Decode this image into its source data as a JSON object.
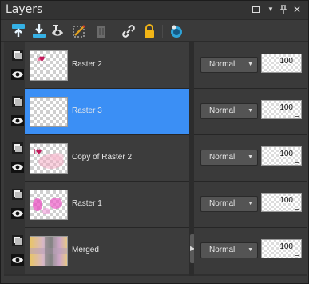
{
  "panel": {
    "title": "Layers",
    "title_buttons": [
      "restore-icon",
      "menu-dropdown-icon",
      "pin-icon",
      "close-icon"
    ]
  },
  "toolbar": {
    "tools": [
      "new-layer-icon",
      "merge-down-icon",
      "visibility-toggle-icon",
      "edit-selection-icon",
      "delete-layer-icon",
      "link-icon",
      "lock-icon",
      "layer-styles-icon"
    ]
  },
  "layers": [
    {
      "name": "Raster 2",
      "selected": false,
      "visible": true,
      "blend_mode": "Normal",
      "opacity": "100"
    },
    {
      "name": "Raster 3",
      "selected": true,
      "visible": true,
      "blend_mode": "Normal",
      "opacity": "100"
    },
    {
      "name": "Copy of Raster 2",
      "selected": false,
      "visible": true,
      "blend_mode": "Normal",
      "opacity": "100"
    },
    {
      "name": "Raster 1",
      "selected": false,
      "visible": true,
      "blend_mode": "Normal",
      "opacity": "100"
    },
    {
      "name": "Merged",
      "selected": false,
      "visible": true,
      "blend_mode": "Normal",
      "opacity": "100"
    }
  ],
  "colors": {
    "selection": "#3b8ff5",
    "panel_bg": "#3a3a3a",
    "accent_tool": "#2ea3d8"
  }
}
